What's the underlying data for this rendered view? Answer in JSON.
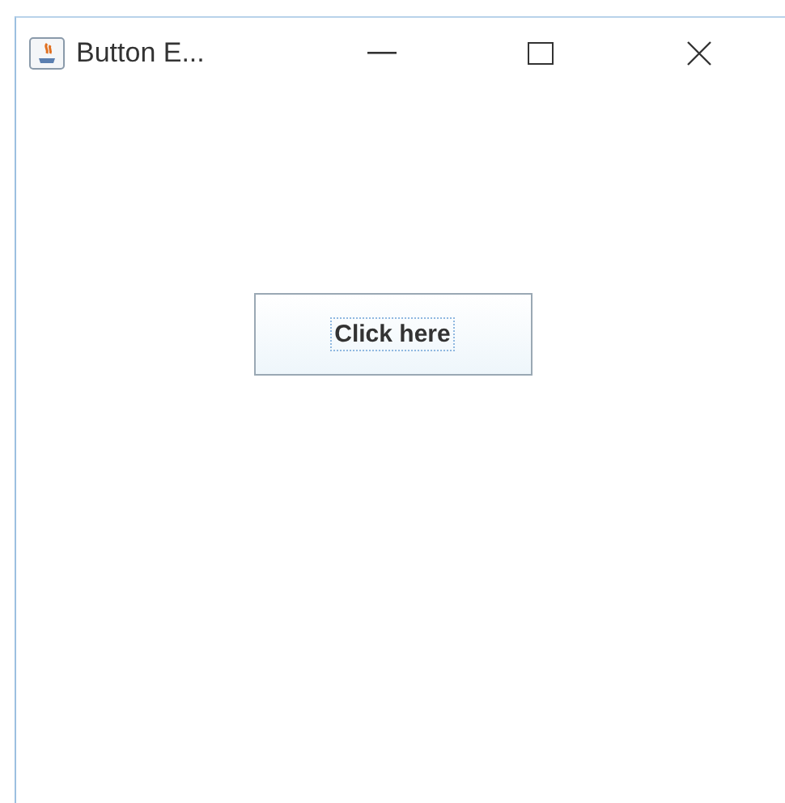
{
  "window": {
    "title": "Button E..."
  },
  "content": {
    "button": {
      "label": "Click here",
      "focused": true
    }
  }
}
